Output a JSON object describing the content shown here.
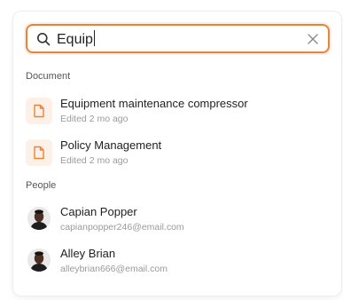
{
  "search": {
    "value": "Equip",
    "placeholder": ""
  },
  "sections": {
    "documents": {
      "title": "Document",
      "items": [
        {
          "title": "Equipment maintenance compressor",
          "subtitle": "Edited 2 mo ago",
          "icon": "document-icon"
        },
        {
          "title": "Policy Management",
          "subtitle": "Edited 2 mo ago",
          "icon": "document-icon"
        }
      ]
    },
    "people": {
      "title": "People",
      "items": [
        {
          "name": "Capian Popper",
          "email": "capianpopper246@email.com",
          "icon": "avatar"
        },
        {
          "name": "Alley Brian",
          "email": "alleybrian666@email.com",
          "icon": "avatar"
        }
      ]
    }
  },
  "colors": {
    "accent": "#e8833a",
    "icon_bg": "#fdf0e6"
  }
}
